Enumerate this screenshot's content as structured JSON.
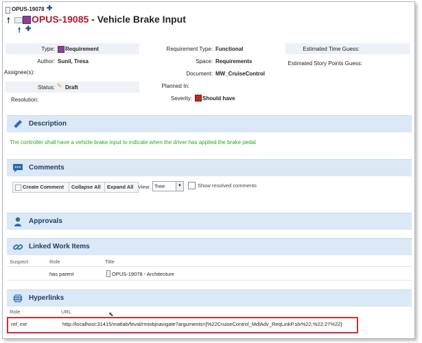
{
  "header": {
    "parent_id": "OPUS-19078",
    "item_id": "OPUS-19085",
    "title_sep": " - ",
    "item_title": "Vehicle Brake Input"
  },
  "properties": {
    "type_label": "Type:",
    "type_value": "Requirement",
    "author_label": "Author:",
    "author_value": "Sunil, Tresa",
    "assignees_label": "Assignee(s):",
    "status_label": "Status:",
    "status_value": "Draft",
    "resolution_label": "Resolution:",
    "req_type_label": "Requirement Type:",
    "req_type_value": "Functional",
    "space_label": "Space:",
    "space_value": "Requirements",
    "document_label": "Document:",
    "document_value": "MW_CruiseControl",
    "planned_label": "Planned In:",
    "severity_label": "Severity:",
    "severity_value": "Should have",
    "est_time_label": "Estimated Time Guess:",
    "est_points_label": "Estimated Story Points Guess:"
  },
  "sections": {
    "description": "Description",
    "comments": "Comments",
    "approvals": "Approvals",
    "linked": "Linked Work Items",
    "hyperlinks": "Hyperlinks"
  },
  "description_text": "The controller shall have a vehicle brake input to indicate when the driver has applied the brake pedal",
  "comments_toolbar": {
    "create": "Create Comment",
    "collapse": "Collapse All",
    "expand": "Expand All",
    "view_label": "View:",
    "view_value": "Tree",
    "show_resolved": "Show resolved comments"
  },
  "linked_table": {
    "headers": [
      "Suspect",
      "Role",
      "Title"
    ],
    "rows": [
      {
        "suspect": "",
        "role": "has parent",
        "title": "OPUS-19078 - Architecture"
      }
    ]
  },
  "hyperlinks_table": {
    "headers": [
      "Role",
      "URL"
    ],
    "rows": [
      {
        "role": "ref_ext",
        "url": "http://localhost:31415/matlab/feval/rmiobjnavigate?arguments=[%22CruiseControl_MdlAdv_ReqLinkP.slx%22,%22:27%22]"
      }
    ]
  },
  "colors": {
    "title_red": "#b0192c",
    "section_bg": "#dbe8f5",
    "section_title": "#1d3e66",
    "description_green": "#2aa52a",
    "highlight_red": "#d8282d"
  }
}
